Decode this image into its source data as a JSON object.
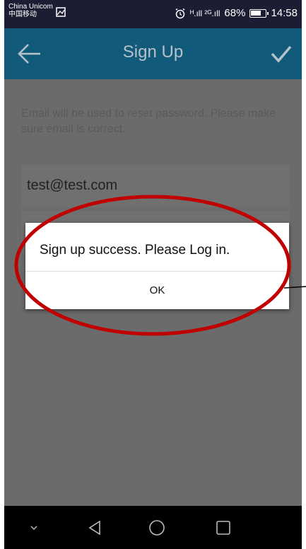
{
  "status_bar": {
    "carrier_line1": "China Unicom",
    "carrier_line2": "中国移动",
    "signal_text": "ᴴ.ıll ²ᴳ.ıll",
    "battery": "68%",
    "time": "14:58",
    "icons": [
      "image-icon",
      "alarm-icon",
      "signal-icon",
      "battery-icon"
    ]
  },
  "app_bar": {
    "title": "Sign Up",
    "color": "#125a79",
    "left_icon": "back-arrow-icon",
    "right_icon": "check-icon"
  },
  "form": {
    "hint": "Email will be used to reset password. Please make sure email is correct.",
    "email_value": "test@test.com"
  },
  "dialog": {
    "message": "Sign up success. Please Log in.",
    "ok_label": "OK"
  },
  "annotation": {
    "color": "#c00000"
  },
  "nav_bar": {
    "icons": [
      "chevron-down-icon",
      "back-triangle-icon",
      "home-circle-icon",
      "recents-square-icon"
    ]
  }
}
